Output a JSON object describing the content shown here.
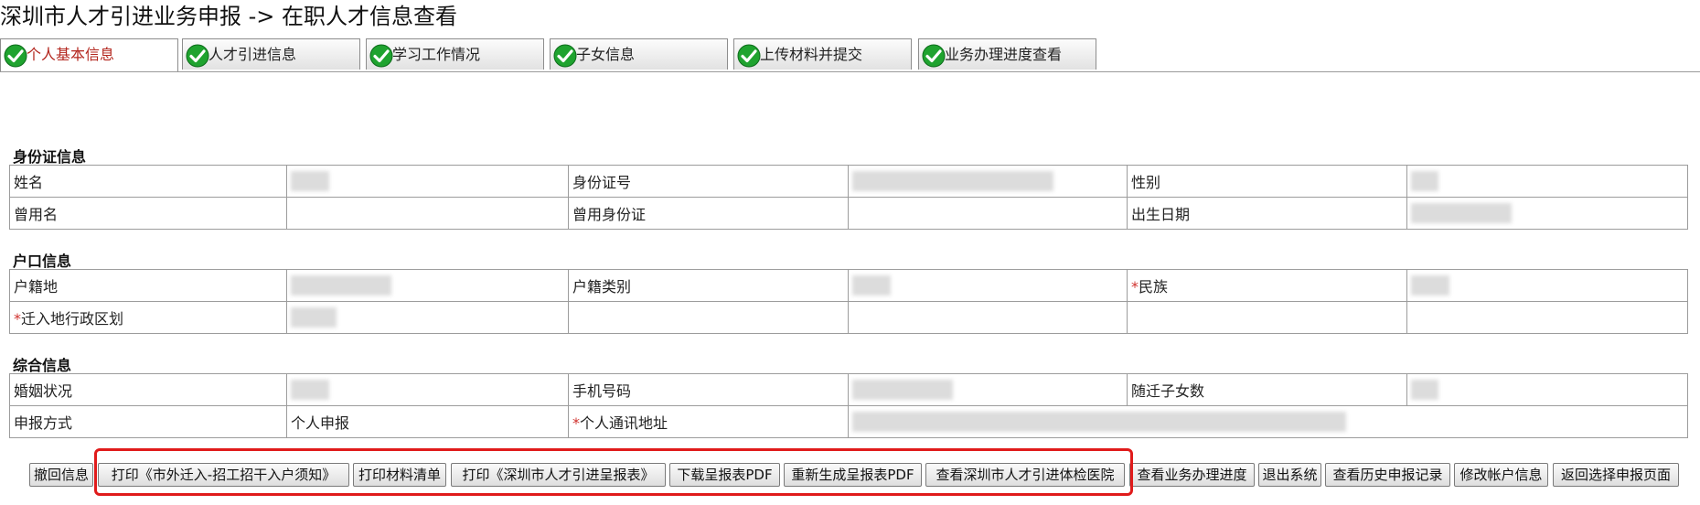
{
  "page": {
    "title": "深圳市人才引进业务申报 -> 在职人才信息查看"
  },
  "tabs": [
    {
      "label": "个人基本信息",
      "active": true
    },
    {
      "label": "人才引进信息"
    },
    {
      "label": "学习工作情况"
    },
    {
      "label": "子女信息"
    },
    {
      "label": "上传材料并提交"
    },
    {
      "label": "业务办理进度查看"
    }
  ],
  "sections": {
    "id_card": {
      "title": "身份证信息",
      "name_label": "姓名",
      "id_number_label": "身份证号",
      "gender_label": "性别",
      "former_name_label": "曾用名",
      "former_id_label": "曾用身份证",
      "birth_date_label": "出生日期"
    },
    "hukou": {
      "title": "户口信息",
      "registered_place_label": "户籍地",
      "hukou_type_label": "户籍类别",
      "ethnicity_label": "民族",
      "district_label": "迁入地行政区划",
      "required_mark": "*"
    },
    "general": {
      "title": "综合信息",
      "marital_label": "婚姻状况",
      "phone_label": "手机号码",
      "children_label": "随迁子女数",
      "method_label": "申报方式",
      "method_value": "个人申报",
      "address_label": "个人通讯地址",
      "required_mark": "*"
    }
  },
  "actions": {
    "withdraw": "撤回信息",
    "print_notice": "打印《市外迁入-招工招干入户须知》",
    "print_materials": "打印材料清单",
    "print_form": "打印《深圳市人才引进呈报表》",
    "download_pdf": "下载呈报表PDF",
    "regenerate_pdf": "重新生成呈报表PDF",
    "view_hospital": "查看深圳市人才引进体检医院",
    "view_progress": "查看业务办理进度",
    "logout": "退出系统",
    "view_history": "查看历史申报记录",
    "edit_account": "修改帐户信息",
    "back": "返回选择申报页面"
  },
  "colors": {
    "active_tab_text": "#b3261e",
    "check_green": "#1fa32f",
    "required": "#d0312d",
    "highlight": "#e01b1b"
  }
}
